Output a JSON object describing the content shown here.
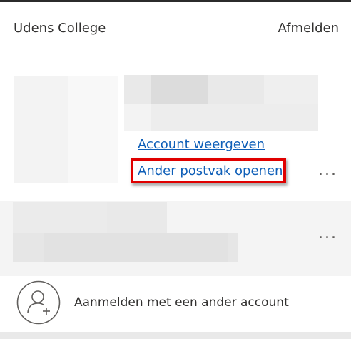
{
  "header": {
    "organization": "Udens College",
    "sign_out_label": "Afmelden"
  },
  "primary_account": {
    "view_account_link": "Account weergeven",
    "open_mailbox_link": "Ander postvak openen",
    "more_label": "..."
  },
  "secondary_account": {
    "more_label": "..."
  },
  "other_account": {
    "label": "Aanmelden met een ander account",
    "icon": "person-add-icon"
  },
  "colors": {
    "link": "#0f5fb8",
    "highlight": "#e00000"
  }
}
